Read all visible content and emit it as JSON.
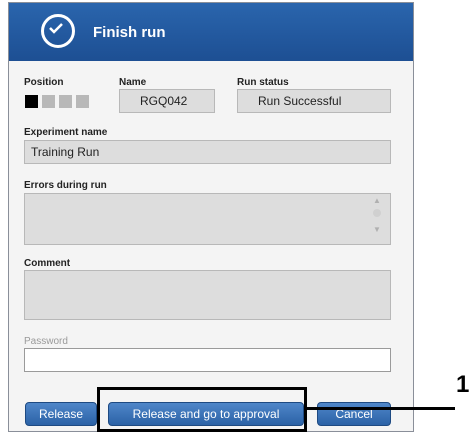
{
  "dialog": {
    "title": "Finish run",
    "title_icon": "checkmark-circle-icon"
  },
  "position": {
    "label": "Position",
    "slots": [
      {
        "state": "active",
        "color": "#000000"
      },
      {
        "state": "inactive",
        "color": "#b8b8b8"
      },
      {
        "state": "inactive",
        "color": "#b8b8b8"
      },
      {
        "state": "inactive",
        "color": "#b8b8b8"
      }
    ]
  },
  "name": {
    "label": "Name",
    "value": "RGQ042"
  },
  "run_status": {
    "label": "Run status",
    "value": "Run Successful"
  },
  "experiment": {
    "label": "Experiment name",
    "value": "Training Run"
  },
  "errors": {
    "label": "Errors during run",
    "value": ""
  },
  "comment": {
    "label": "Comment",
    "value": ""
  },
  "password": {
    "label": "Password",
    "value": ""
  },
  "buttons": {
    "release": "Release",
    "release_approval": "Release and go to approval",
    "cancel": "Cancel"
  },
  "callout": {
    "number": "1"
  },
  "colors": {
    "title_bar": "#1d4f93",
    "button": "#2b62a6",
    "field": "#dddddd"
  }
}
